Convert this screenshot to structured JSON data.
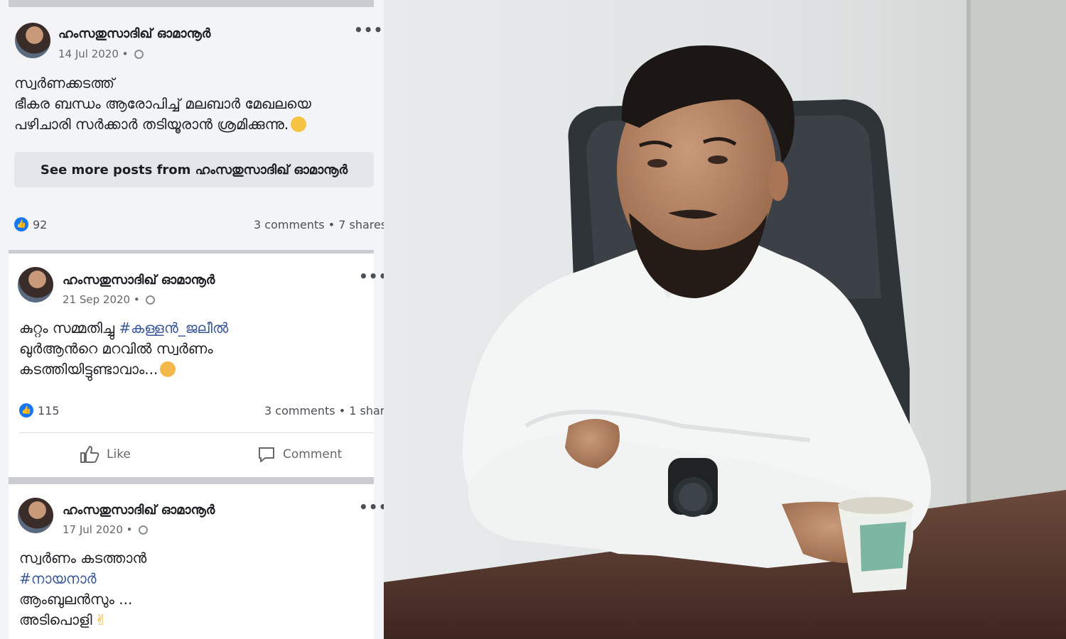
{
  "posts": [
    {
      "author": "ഹംസതുസാദിഖ് ഓമാനൂർ",
      "date": "14 Jul 2020",
      "lines": [
        "സ്വർണക്കടത്ത്",
        "ഭീകര ബന്ധം ആരോപിച്ച് മലബാർ മേഖലയെ",
        "പഴിചാരി സർക്കാർ തടിയൂരാൻ ശ്രമിക്കുന്നു."
      ],
      "see_more": "See more posts from ഹംസതുസാദിഖ് ഓമാനൂർ",
      "likes": "92",
      "stats": "3 comments • 7 shares"
    },
    {
      "author": "ഹംസതുസാദിഖ് ഓമാനൂർ",
      "date": "21 Sep 2020",
      "line1_text": "കുറ്റം സമ്മതിച്ചു ",
      "line1_hashtag": "#കള്ളൻ_ജലീൽ",
      "line2": "ഖുർആൻറെ മറവിൽ സ്വർണം",
      "line3": "കടത്തിയിട്ടുണ്ടാവാം...",
      "likes": "115",
      "stats": "3 comments • 1 shar",
      "like_label": "Like",
      "comment_label": "Comment"
    },
    {
      "author": "ഹംസതുസാദിഖ് ഓമാനൂർ",
      "date": "17 Jul 2020",
      "line1": "സ്വർണം കടത്താൻ",
      "hashtag": "#നായനാർ",
      "line3": "ആംബുലൻസും ...",
      "line4": "അടിപൊളി"
    }
  ],
  "icons": {
    "more": "more-options-icon",
    "privacy": "globe-icon",
    "reaction": "thumbs-up-icon",
    "like": "like-icon",
    "comment": "comment-icon"
  },
  "colors": {
    "facebook_blue": "#1877f2",
    "hashtag": "#385898",
    "panel_bg": "#f3f4f8"
  }
}
